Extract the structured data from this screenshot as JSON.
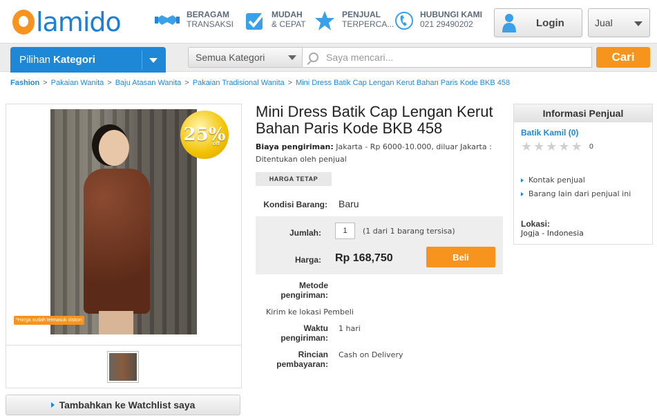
{
  "brand": {
    "logo": "lamido",
    "accent": "#1e88d6",
    "orange": "#f7941d"
  },
  "header": {
    "features": [
      {
        "title": "BERAGAM",
        "sub": "TRANSAKSI",
        "icon": "handshake-icon"
      },
      {
        "title": "MUDAH",
        "sub": "& CEPAT",
        "icon": "checkbox-icon"
      },
      {
        "title": "PENJUAL",
        "sub": "TERPERCA...",
        "icon": "star-icon"
      },
      {
        "title": "HUBUNGI KAMI",
        "sub": "021 29490202",
        "icon": "phone-icon"
      }
    ],
    "login_label": "Login",
    "jual_label": "Jual"
  },
  "nav": {
    "kategori_prefix": "Pilihan",
    "kategori_bold": "Kategori",
    "category_select": "Semua Kategori",
    "search_placeholder": "Saya mencari...",
    "search_button": "Cari"
  },
  "breadcrumb": [
    "Fashion",
    "Pakaian Wanita",
    "Baju Atasan Wanita",
    "Pakaian Tradisional Wanita",
    "Mini Dress Batik Cap Lengan Kerut Bahan Paris Kode BKB 458"
  ],
  "image_panel": {
    "discount_value": "25%",
    "discount_suffix": "off",
    "note": "*Harga sudah termasuk diskon",
    "watchlist_label": "Tambahkan ke Watchlist saya"
  },
  "product": {
    "title": "Mini Dress Batik Cap Lengan Kerut Bahan Paris Kode BKB 458",
    "shipping_label": "Biaya pengiriman:",
    "shipping_text": "Jakarta - Rp 6000-10.000, diluar Jakarta : Ditentukan oleh penjual",
    "tag": "HARGA TETAP",
    "kondisi_label": "Kondisi Barang:",
    "kondisi_value": "Baru",
    "jumlah_label": "Jumlah:",
    "qty_value": "1",
    "availability": "(1 dari 1 barang tersisa)",
    "harga_label": "Harga:",
    "price": "Rp  168,750",
    "beli_label": "Beli",
    "metode_label_1": "Metode",
    "metode_label_2": "pengiriman:",
    "metode_value": "Kirim ke lokasi Pembeli",
    "waktu_label_1": "Waktu",
    "waktu_label_2": "pengiriman:",
    "waktu_value": "1 hari",
    "rincian_label_1": "Rincian",
    "rincian_label_2": "pembayaran:",
    "rincian_value": "Cash on Delivery"
  },
  "seller": {
    "header": "Informasi Penjual",
    "name": "Batik Kamil",
    "score": "(0)",
    "rating_count": "0",
    "links": [
      "Kontak penjual",
      "Barang lain dari penjual ini"
    ],
    "lokasi_label": "Lokasi:",
    "lokasi_value": "Jogja - Indonesia"
  }
}
